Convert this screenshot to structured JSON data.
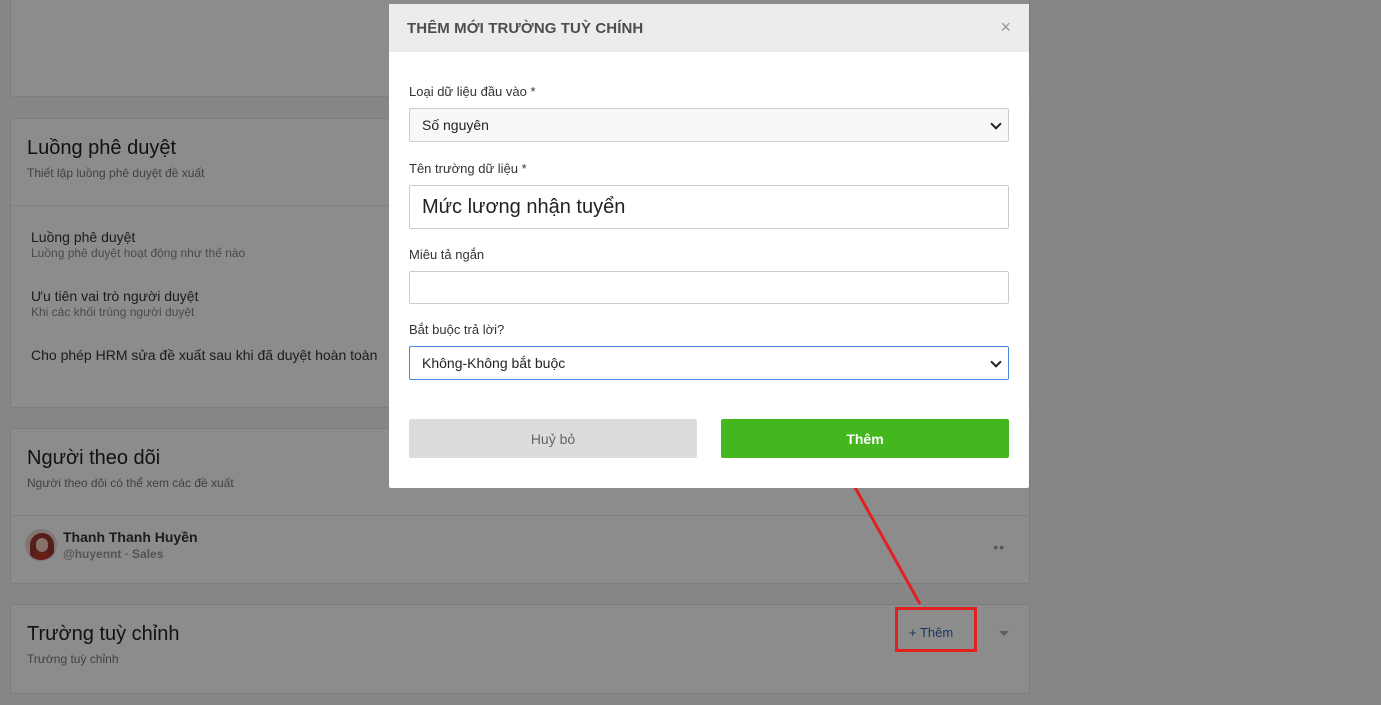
{
  "background": {
    "approval": {
      "title": "Luồng phê duyệt",
      "subtitle": "Thiết lập luồng phê duyệt đề xuất",
      "settings": [
        {
          "label": "Luồng phê duyệt",
          "desc": "Luồng phê duyệt hoạt động như thế nào"
        },
        {
          "label": "Ưu tiên vai trò người duyệt",
          "desc": "Khi các khối trùng người duyệt"
        },
        {
          "label": "Cho phép HRM sửa đề xuất sau khi đã duyệt hoàn toàn",
          "desc": ""
        }
      ]
    },
    "followers": {
      "title": "Người theo dõi",
      "subtitle": "Người theo dõi có thể xem các đề xuất",
      "user": {
        "name": "Thanh Thanh Huyền",
        "meta": "@huyennt · Sales",
        "more": "••"
      }
    },
    "custom_fields": {
      "title": "Trường tuỳ chỉnh",
      "subtitle": "Trường tuỳ chỉnh",
      "add_label": "+ Thêm"
    }
  },
  "modal": {
    "title": "THÊM MỚI TRƯỜNG TUỲ CHÍNH",
    "close": "×",
    "fields": {
      "data_type": {
        "label": "Loại dữ liệu đầu vào *",
        "value": "Số nguyên"
      },
      "field_name": {
        "label": "Tên trường dữ liệu *",
        "value": "Mức lương nhận tuyển"
      },
      "short_desc": {
        "label": "Miêu tả ngắn",
        "value": ""
      },
      "required": {
        "label": "Bắt buộc trả lời?",
        "value": "Không-Không bắt buộc"
      }
    },
    "cancel_label": "Huỷ bỏ",
    "submit_label": "Thêm"
  },
  "colors": {
    "primary_green": "#44b71e",
    "link_blue": "#2f66b3",
    "annotation_red": "#e32020"
  }
}
